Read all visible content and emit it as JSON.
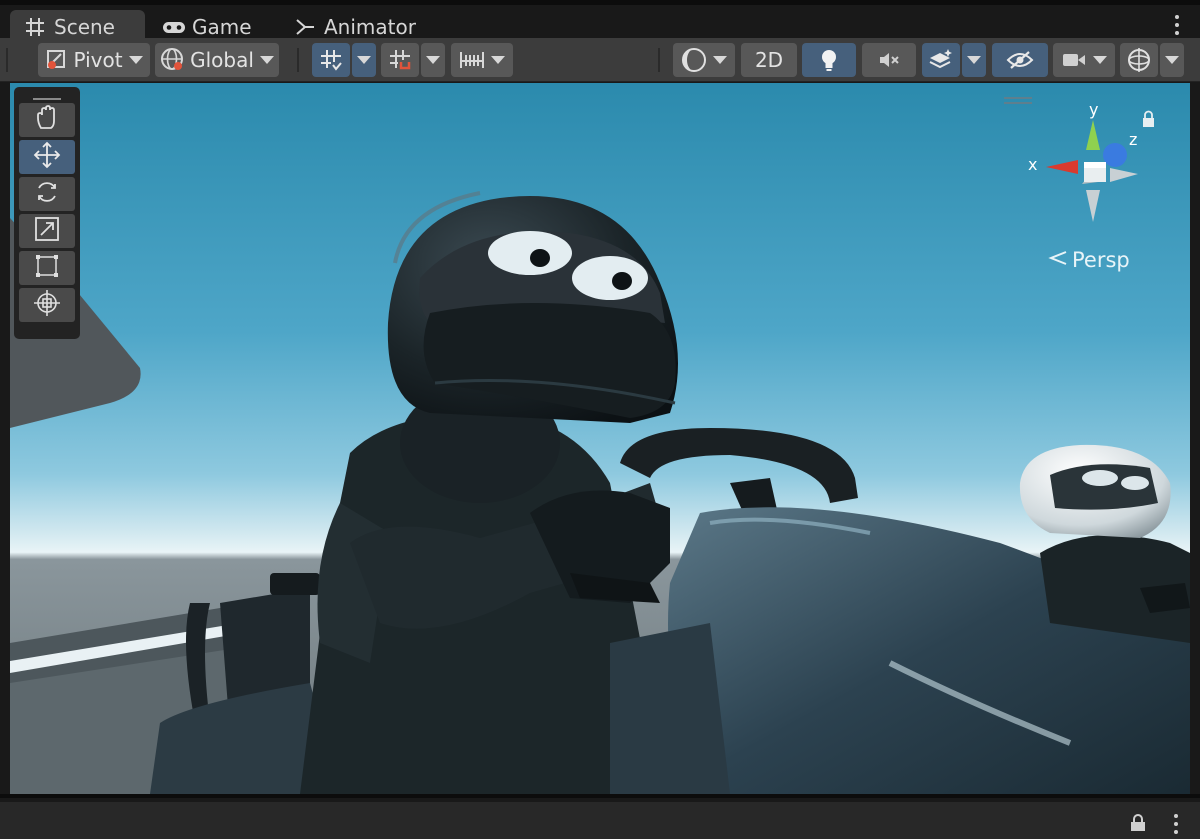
{
  "tabs": [
    {
      "label": "Scene",
      "icon": "grid-icon",
      "active": true
    },
    {
      "label": "Game",
      "icon": "gamepad-icon",
      "active": false
    },
    {
      "label": "Animator",
      "icon": "animator-icon",
      "active": false
    }
  ],
  "toolbar": {
    "pivot_label": "Pivot",
    "global_label": "Global",
    "mode_2d_label": "2D"
  },
  "gizmo": {
    "x_label": "x",
    "y_label": "y",
    "z_label": "z",
    "projection_label": "Persp"
  },
  "tools": [
    "hand-tool-icon",
    "move-tool-icon",
    "rotate-tool-icon",
    "scale-tool-icon",
    "rect-tool-icon",
    "transform-tool-icon"
  ],
  "active_tool": "move-tool-icon",
  "colors": {
    "accent": "#46607c",
    "panel": "#3c3c3c",
    "sky_top": "#2b8aad",
    "gizmo_x": "#d93a2e",
    "gizmo_y": "#8fd14f",
    "gizmo_z": "#3a7be0"
  }
}
